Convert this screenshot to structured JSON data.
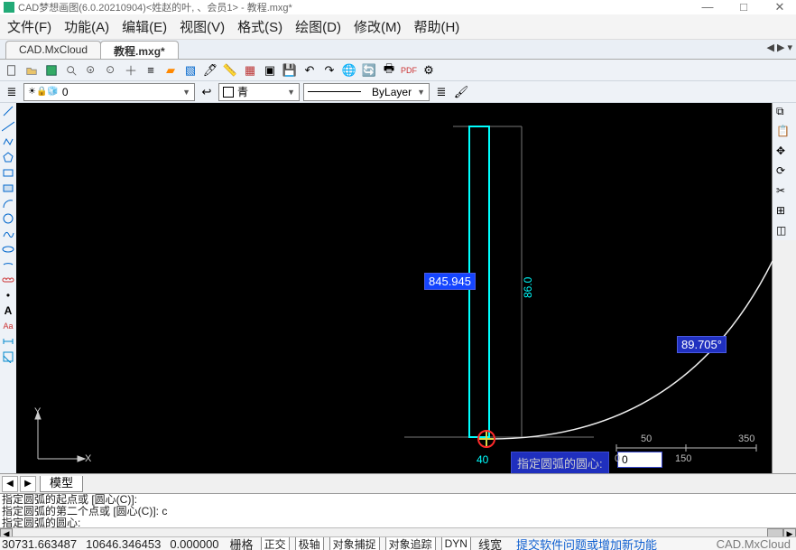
{
  "window": {
    "title": "CAD梦想画图(6.0.20210904)<姓赵的叶, 、会员1> - 教程.mxg*",
    "min_icon": "—",
    "max_icon": "□",
    "close_icon": "✕"
  },
  "menu": {
    "file": "文件(F)",
    "function": "功能(A)",
    "edit": "编辑(E)",
    "view": "视图(V)",
    "format": "格式(S)",
    "draw": "绘图(D)",
    "modify": "修改(M)",
    "help": "帮助(H)"
  },
  "tabs": {
    "t1": "CAD.MxCloud",
    "t2": "教程.mxg*"
  },
  "layer": {
    "current": "0"
  },
  "colorbox": {
    "label": "青",
    "swatch": "#00ffff"
  },
  "linetype": {
    "label": "ByLayer"
  },
  "canvas": {
    "dist_label": "845.945",
    "angle_label": "89.705°",
    "dim_v": "86.0",
    "dim_h": "40",
    "prompt": "指定圆弧的圆心:",
    "prompt_value": "0",
    "scale_a": "50",
    "scale_b": "350",
    "scale_c": "0",
    "scale_d": "150",
    "ucs_x": "X",
    "ucs_y": "Y"
  },
  "sheet_tab": "模型",
  "command_lines": {
    "l1": "指定圆弧的起点或 [圆心(C)]:",
    "l2": "指定圆弧的第二个点或 [圆心(C)]:  c",
    "l3": "指定圆弧的圆心:"
  },
  "status": {
    "x": "30731.663487",
    "y": "10646.346453",
    "z": "0.000000",
    "grid": "栅格",
    "ortho": "正交",
    "polar": "极轴",
    "osnap": "对象捕捉",
    "otrack": "对象追踪",
    "dyn": "DYN",
    "lwt": "线宽",
    "feedback": "提交软件问题或增加新功能",
    "brand": "CAD.MxCloud"
  },
  "icons": {
    "layer_states": "☀🔒🧊",
    "brush": "🖌"
  }
}
